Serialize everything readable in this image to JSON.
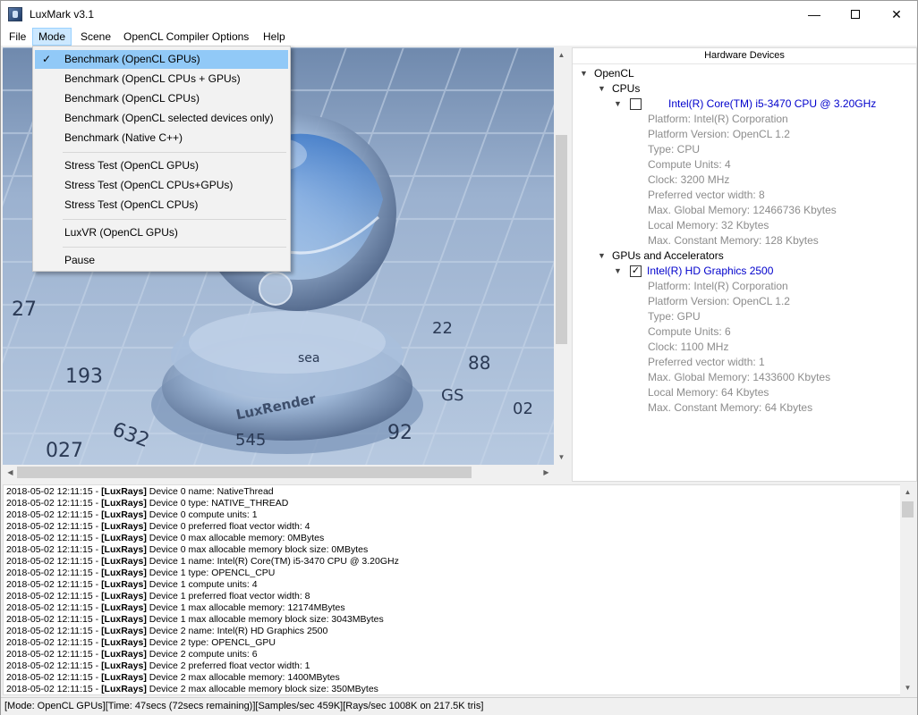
{
  "window": {
    "title": "LuxMark v3.1",
    "minimize": "—",
    "close": "✕"
  },
  "menu": {
    "items": [
      {
        "label": "File"
      },
      {
        "label": "Mode"
      },
      {
        "label": "Scene"
      },
      {
        "label": "OpenCL Compiler Options"
      },
      {
        "label": "Help"
      }
    ]
  },
  "mode_menu": {
    "check": "✓",
    "items": [
      {
        "label": "Benchmark (OpenCL GPUs)",
        "checked": true
      },
      {
        "label": "Benchmark (OpenCL CPUs + GPUs)"
      },
      {
        "label": "Benchmark (OpenCL CPUs)"
      },
      {
        "label": "Benchmark (OpenCL selected devices only)"
      },
      {
        "label": "Benchmark (Native C++)"
      },
      {
        "label": "Stress Test (OpenCL GPUs)"
      },
      {
        "label": "Stress Test (OpenCL CPUs+GPUs)"
      },
      {
        "label": "Stress Test (OpenCL CPUs)"
      },
      {
        "label": "LuxVR (OpenCL GPUs)"
      },
      {
        "label": "Pause"
      }
    ]
  },
  "scene": {
    "tiles": [
      "27",
      "193",
      "632",
      "92",
      "027",
      "545",
      "88",
      "sea",
      "GS",
      "02",
      "22"
    ],
    "logo_text": "LuxRender"
  },
  "hardware": {
    "header": "Hardware Devices",
    "root": "OpenCL",
    "cpus_label": "CPUs",
    "cpu": {
      "name": "Intel(R) Core(TM) i5-3470 CPU @ 3.20GHz",
      "checked": false,
      "props": [
        "Platform: Intel(R) Corporation",
        "Platform Version: OpenCL 1.2",
        "Type: CPU",
        "Compute Units: 4",
        "Clock: 3200 MHz",
        "Preferred vector width: 8",
        "Max. Global Memory: 12466736 Kbytes",
        "Local Memory: 32 Kbytes",
        "Max. Constant Memory: 128 Kbytes"
      ]
    },
    "gpus_label": "GPUs and Accelerators",
    "gpu": {
      "name": "Intel(R) HD Graphics 2500",
      "checked": true,
      "check": "✓",
      "props": [
        "Platform: Intel(R) Corporation",
        "Platform Version: OpenCL 1.2",
        "Type: GPU",
        "Compute Units: 6",
        "Clock: 1100 MHz",
        "Preferred vector width: 1",
        "Max. Global Memory: 1433600 Kbytes",
        "Local Memory: 64 Kbytes",
        "Max. Constant Memory: 64 Kbytes"
      ]
    }
  },
  "log": {
    "lines": [
      {
        "ts": "2018-05-02 12:11:15 - ",
        "tag": "[LuxRays]",
        "msg": " Device 0 name: NativeThread"
      },
      {
        "ts": "2018-05-02 12:11:15 - ",
        "tag": "[LuxRays]",
        "msg": " Device 0 type: NATIVE_THREAD"
      },
      {
        "ts": "2018-05-02 12:11:15 - ",
        "tag": "[LuxRays]",
        "msg": " Device 0 compute units: 1"
      },
      {
        "ts": "2018-05-02 12:11:15 - ",
        "tag": "[LuxRays]",
        "msg": " Device 0 preferred float vector width: 4"
      },
      {
        "ts": "2018-05-02 12:11:15 - ",
        "tag": "[LuxRays]",
        "msg": " Device 0 max allocable memory: 0MBytes"
      },
      {
        "ts": "2018-05-02 12:11:15 - ",
        "tag": "[LuxRays]",
        "msg": " Device 0 max allocable memory block size: 0MBytes"
      },
      {
        "ts": "2018-05-02 12:11:15 - ",
        "tag": "[LuxRays]",
        "msg": " Device 1 name: Intel(R) Core(TM) i5-3470 CPU @ 3.20GHz"
      },
      {
        "ts": "2018-05-02 12:11:15 - ",
        "tag": "[LuxRays]",
        "msg": " Device 1 type: OPENCL_CPU"
      },
      {
        "ts": "2018-05-02 12:11:15 - ",
        "tag": "[LuxRays]",
        "msg": " Device 1 compute units: 4"
      },
      {
        "ts": "2018-05-02 12:11:15 - ",
        "tag": "[LuxRays]",
        "msg": " Device 1 preferred float vector width: 8"
      },
      {
        "ts": "2018-05-02 12:11:15 - ",
        "tag": "[LuxRays]",
        "msg": " Device 1 max allocable memory: 12174MBytes"
      },
      {
        "ts": "2018-05-02 12:11:15 - ",
        "tag": "[LuxRays]",
        "msg": " Device 1 max allocable memory block size: 3043MBytes"
      },
      {
        "ts": "2018-05-02 12:11:15 - ",
        "tag": "[LuxRays]",
        "msg": " Device 2 name: Intel(R) HD Graphics 2500"
      },
      {
        "ts": "2018-05-02 12:11:15 - ",
        "tag": "[LuxRays]",
        "msg": " Device 2 type: OPENCL_GPU"
      },
      {
        "ts": "2018-05-02 12:11:15 - ",
        "tag": "[LuxRays]",
        "msg": " Device 2 compute units: 6"
      },
      {
        "ts": "2018-05-02 12:11:15 - ",
        "tag": "[LuxRays]",
        "msg": " Device 2 preferred float vector width: 1"
      },
      {
        "ts": "2018-05-02 12:11:15 - ",
        "tag": "[LuxRays]",
        "msg": " Device 2 max allocable memory: 1400MBytes"
      },
      {
        "ts": "2018-05-02 12:11:15 - ",
        "tag": "[LuxRays]",
        "msg": " Device 2 max allocable memory block size: 350MBytes"
      }
    ]
  },
  "status": "[Mode: OpenCL GPUs][Time: 47secs (72secs remaining)][Samples/sec    459K][Rays/sec    1008K on 217.5K tris]"
}
